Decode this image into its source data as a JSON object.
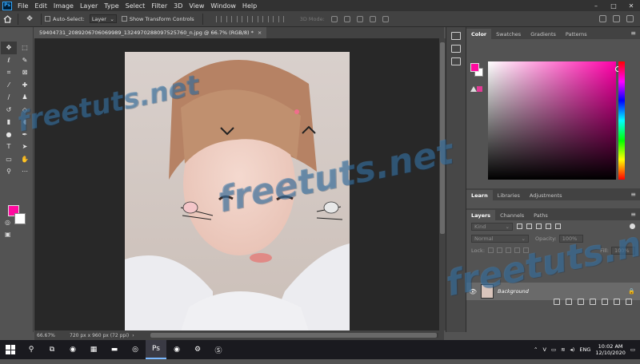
{
  "menubar": {
    "logo": "Ps",
    "items": [
      "File",
      "Edit",
      "Image",
      "Layer",
      "Type",
      "Select",
      "Filter",
      "3D",
      "View",
      "Window",
      "Help"
    ],
    "window_controls": [
      "–",
      "□",
      "✕"
    ]
  },
  "options_bar": {
    "auto_select_label": "Auto-Select:",
    "auto_select_value": "Layer",
    "show_transform_label": "Show Transform Controls",
    "mode_3d_label": "3D Mode:"
  },
  "document": {
    "tab_title": "59404731_2089206706069989_1324970288097525760_n.jpg @ 66.7% (RGB/8) *",
    "zoom": "66.67%",
    "info": "720 px x 960 px (72 ppi)"
  },
  "colors": {
    "foreground": "#ff0a9f",
    "background": "#ffffff",
    "accent": "#31a8ff"
  },
  "color_panel": {
    "tabs": [
      "Color",
      "Swatches",
      "Gradients",
      "Patterns"
    ],
    "active_tab": "Color"
  },
  "learn_panel": {
    "tabs": [
      "Learn",
      "Libraries",
      "Adjustments"
    ]
  },
  "layers_panel": {
    "tabs": [
      "Layers",
      "Channels",
      "Paths"
    ],
    "filter_kind": "Kind",
    "blend_mode": "Normal",
    "opacity_label": "Opacity:",
    "opacity_value": "100%",
    "lock_label": "Lock:",
    "fill_label": "Fill:",
    "fill_value": "100%",
    "layers": [
      {
        "name": "Background",
        "visible": true,
        "locked": true
      }
    ]
  },
  "watermark": "freetuts.net",
  "taskbar": {
    "language": "ENG",
    "time": "10:02 AM",
    "date": "12/10/2020"
  }
}
